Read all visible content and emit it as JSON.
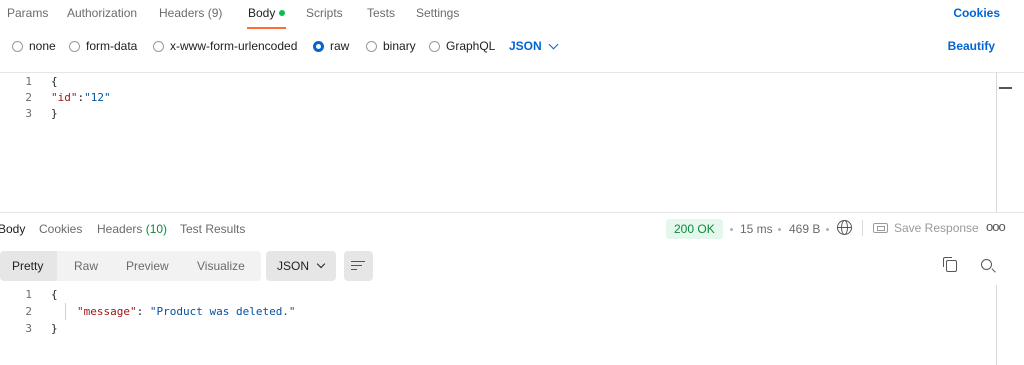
{
  "request_tabs": {
    "params": "Params",
    "authorization": "Authorization",
    "headers": "Headers",
    "headers_count": "(9)",
    "body": "Body",
    "scripts": "Scripts",
    "tests": "Tests",
    "settings": "Settings",
    "cookies": "Cookies"
  },
  "body_types": {
    "options": [
      "none",
      "form-data",
      "x-www-form-urlencoded",
      "raw",
      "binary",
      "GraphQL"
    ],
    "selected": "raw",
    "format": "JSON",
    "beautify": "Beautify"
  },
  "request_editor": {
    "lines": [
      {
        "n": "1",
        "text": "{"
      },
      {
        "n": "2",
        "key": "\"id\"",
        "colon": ":",
        "value": "\"12\""
      },
      {
        "n": "3",
        "text": "}"
      }
    ]
  },
  "response_tabs": {
    "body": "Body",
    "cookies": "Cookies",
    "headers": "Headers",
    "headers_count": "(10)",
    "test_results": "Test Results"
  },
  "response_meta": {
    "status": "200 OK",
    "time": "15 ms",
    "size": "469 B",
    "save_response": "Save Response",
    "more": "ooo",
    "status_color": "#0c8a3e"
  },
  "response_toolbar": {
    "views": [
      "Pretty",
      "Raw",
      "Preview",
      "Visualize"
    ],
    "active_view": "Pretty",
    "format": "JSON"
  },
  "response_editor": {
    "lines": [
      {
        "n": "1",
        "text": "{"
      },
      {
        "n": "2",
        "key": "\"message\"",
        "colon": ": ",
        "value": "\"Product was deleted.\""
      },
      {
        "n": "3",
        "text": "}"
      }
    ]
  },
  "colors": {
    "accent": "#ff6c37",
    "link": "#0265d2",
    "success": "#0c8a3e"
  }
}
